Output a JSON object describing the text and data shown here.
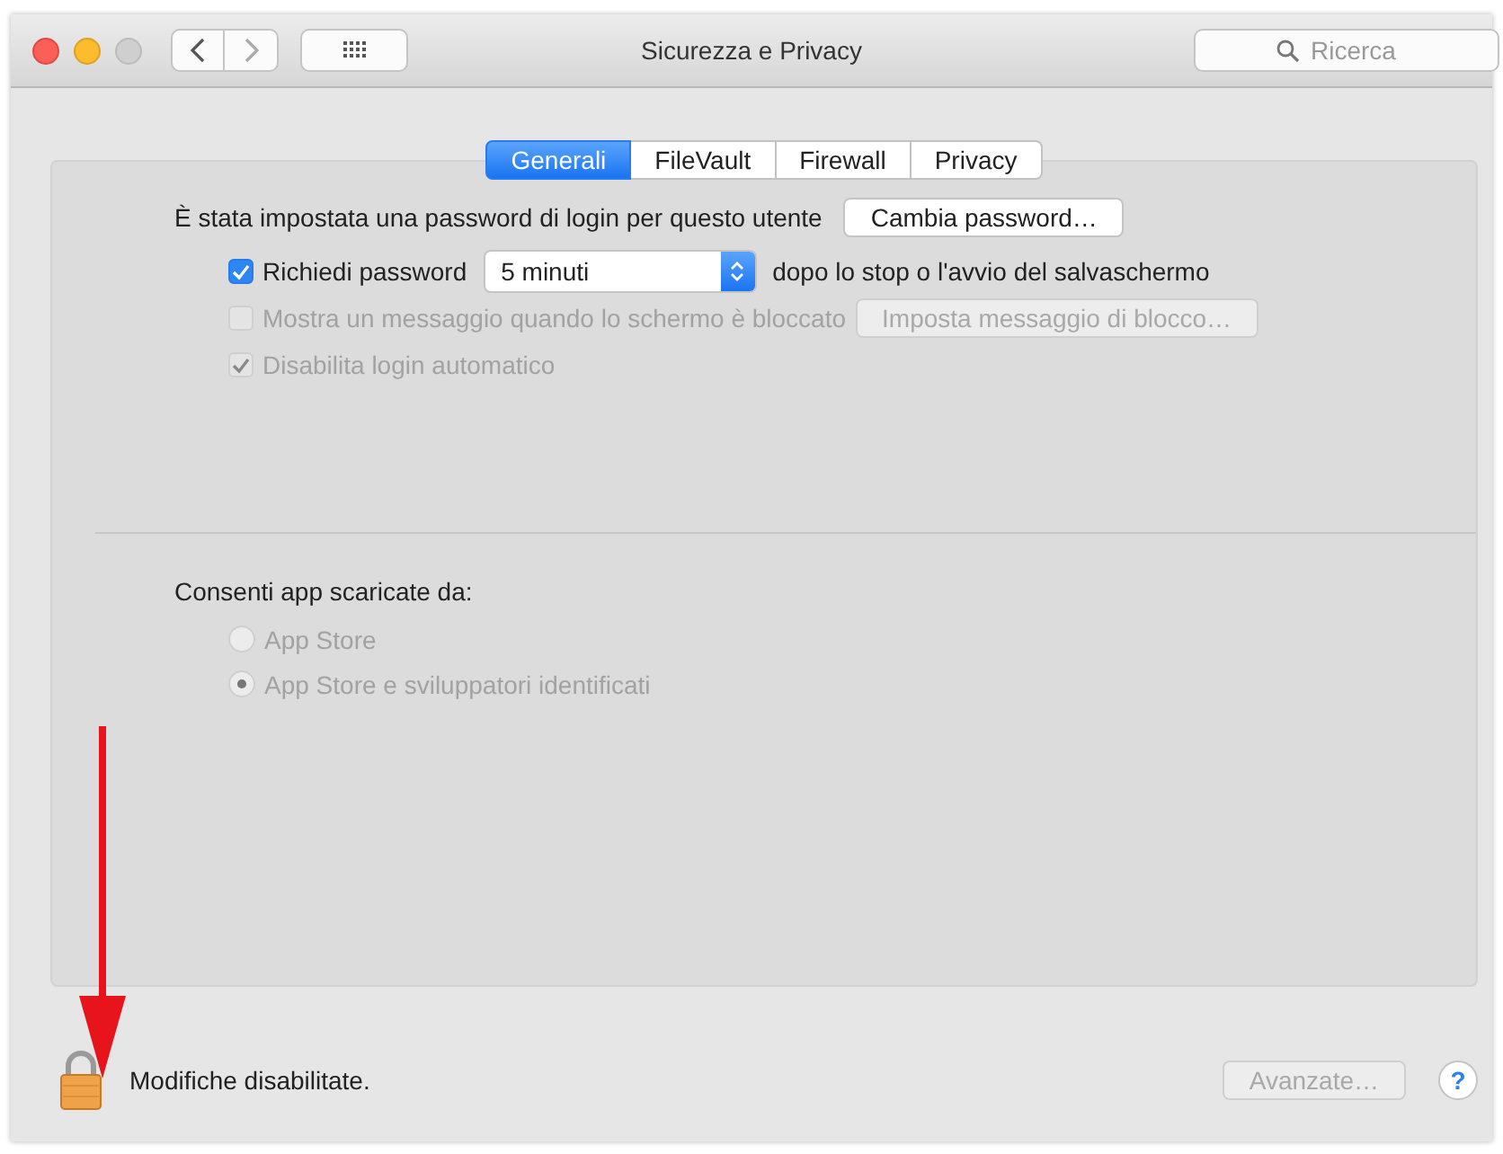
{
  "window": {
    "title": "Sicurezza e Privacy",
    "search": {
      "placeholder": "Ricerca"
    }
  },
  "tabs": [
    {
      "label": "Generali",
      "selected": true
    },
    {
      "label": "FileVault",
      "selected": false
    },
    {
      "label": "Firewall",
      "selected": false
    },
    {
      "label": "Privacy",
      "selected": false
    }
  ],
  "password": {
    "text": "È stata impostata una password di login per questo utente",
    "button": {
      "label": "Cambia password…",
      "disabled": false
    }
  },
  "options": [
    {
      "kind": "select",
      "label": "Richiedi password",
      "checked": true,
      "disabled": false,
      "value": "5 minuti",
      "suffix": "dopo lo stop o l'avvio del salvaschermo"
    },
    {
      "kind": "button",
      "label": "Mostra un messaggio quando lo schermo è bloccato",
      "checked": false,
      "disabled": true,
      "button": "Imposta messaggio di blocco…"
    },
    {
      "kind": "plain",
      "label": "Disabilita login automatico",
      "checked": true,
      "disabled": true
    }
  ],
  "downloads": {
    "heading": "Consenti app scaricate da:",
    "options": [
      {
        "label": "App Store",
        "selected": false,
        "disabled": true
      },
      {
        "label": "App Store e sviluppatori identificati",
        "selected": true,
        "disabled": true
      }
    ]
  },
  "footer": {
    "lock_text": "Modifiche disabilitate.",
    "advanced": {
      "label": "Avanzate…",
      "disabled": true
    },
    "help": "?"
  }
}
